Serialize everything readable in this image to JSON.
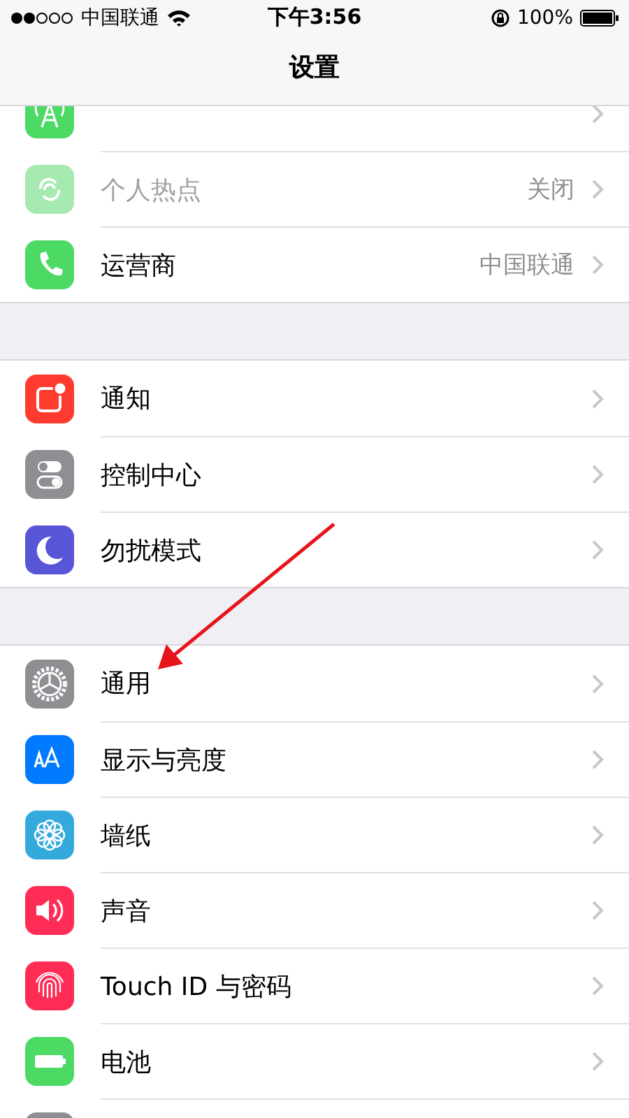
{
  "status_bar": {
    "carrier": "中国联通",
    "time": "下午3:56",
    "battery": "100%"
  },
  "nav_bar": {
    "title": "设置"
  },
  "groups": [
    {
      "items": [
        {
          "kind": "cellular",
          "color": "#4cd964"
        },
        {
          "kind": "hotspot",
          "label": "个人热点",
          "value": "关闭",
          "color": "#a6e9b1",
          "disabled": true
        },
        {
          "kind": "phone",
          "label": "运营商",
          "value": "中国联通",
          "color": "#4cd964",
          "disabled": false
        }
      ]
    },
    {
      "items": [
        {
          "kind": "notifications",
          "label": "通知",
          "color": "#ff3b30",
          "disabled": false
        },
        {
          "kind": "control",
          "label": "控制中心",
          "color": "#8e8e93",
          "disabled": false
        },
        {
          "kind": "moon",
          "label": "勿扰模式",
          "color": "#5856d6",
          "disabled": false
        }
      ]
    },
    {
      "items": [
        {
          "kind": "gear",
          "label": "通用",
          "color": "#8e8e93",
          "disabled": false
        },
        {
          "kind": "display",
          "label": "显示与亮度",
          "color": "#007aff",
          "disabled": false
        },
        {
          "kind": "wallpaper",
          "label": "墙纸",
          "color": "#34aadc",
          "disabled": false
        },
        {
          "kind": "sound",
          "label": "声音",
          "color": "#ff2d55",
          "disabled": false
        },
        {
          "kind": "fingerprint",
          "label": "Touch ID 与密码",
          "color": "#ff2d55",
          "disabled": false
        },
        {
          "kind": "battery",
          "label": "电池",
          "color": "#4cd964",
          "disabled": false
        },
        {
          "kind": "hand",
          "color": "#8e8e93"
        }
      ]
    }
  ]
}
